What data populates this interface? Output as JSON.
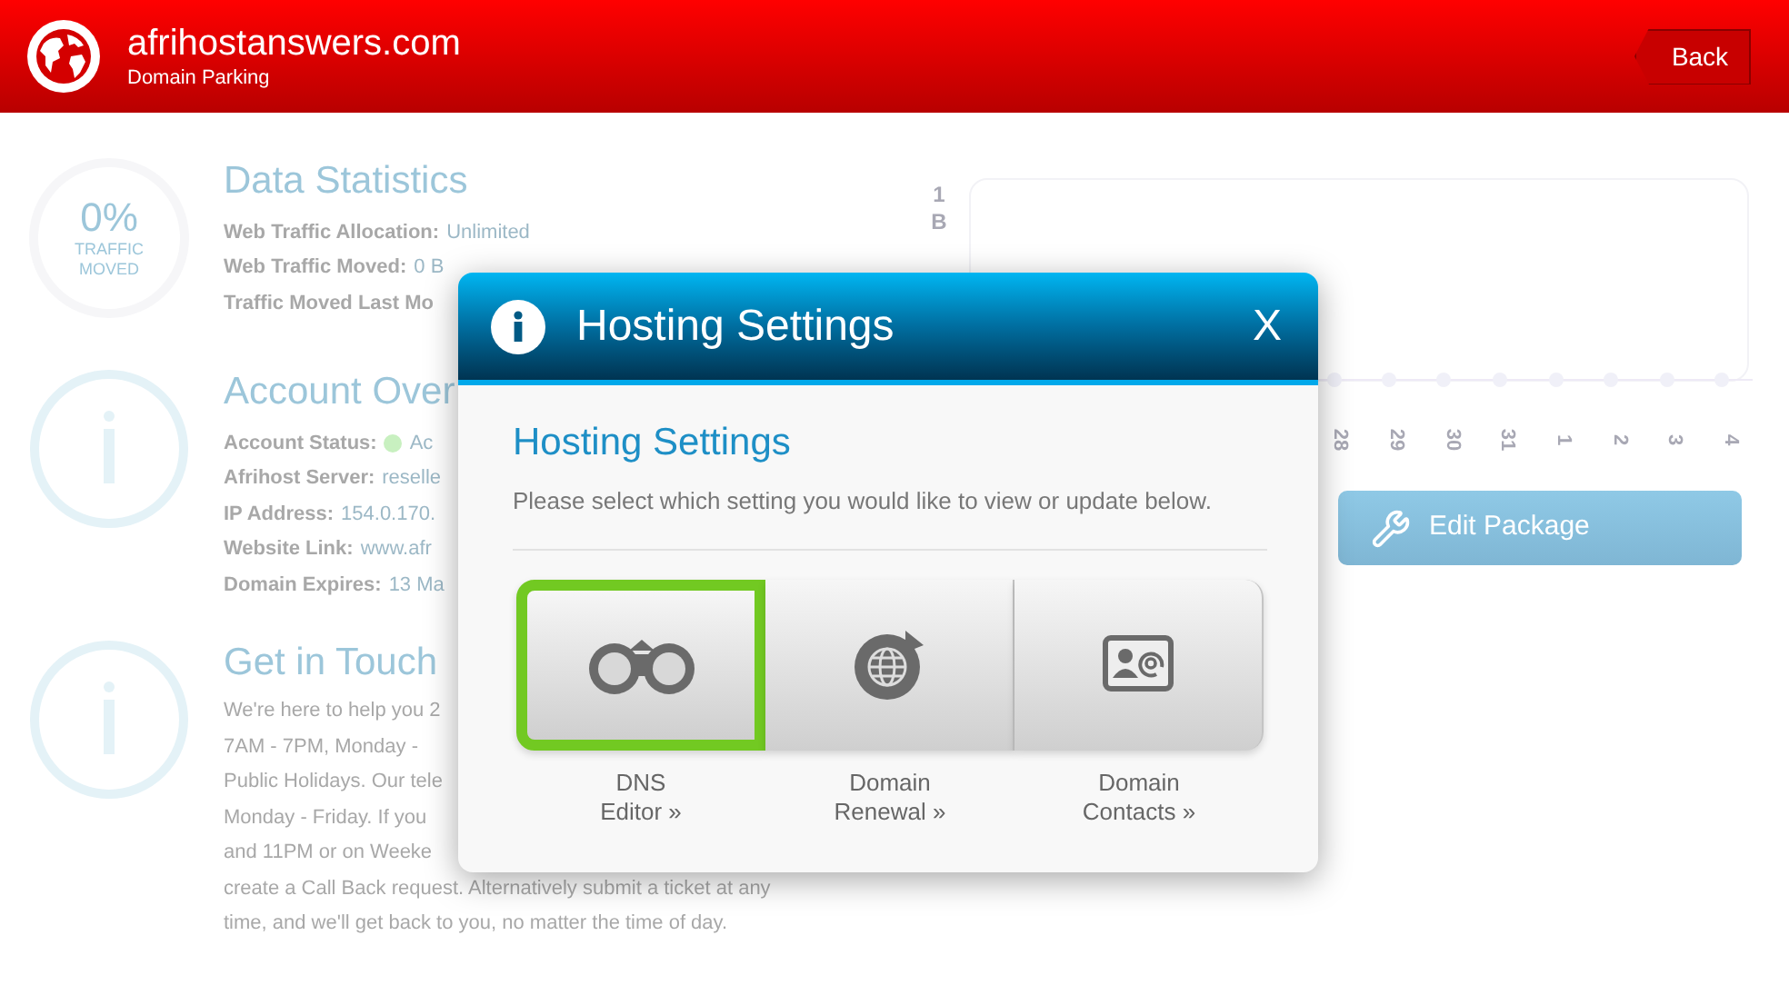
{
  "header": {
    "title": "afrihostanswers.com",
    "subtitle": "Domain Parking",
    "back_button": "Back"
  },
  "sections": [
    {
      "kind": "stat",
      "ring_value": "0%",
      "ring_caption": [
        "TRAFFIC",
        "MOVED"
      ],
      "title": "Data Statistics",
      "rows": [
        {
          "label": "Web Traffic Allocation:",
          "value": "Unlimited"
        },
        {
          "label": "Web Traffic Moved:",
          "value": "0 B"
        },
        {
          "label": "Traffic Moved Last Mo"
        }
      ]
    },
    {
      "kind": "info",
      "title": "Account Over",
      "rows": [
        {
          "label": "Account Status:",
          "value": "Ac",
          "color": "#c8f0c0"
        },
        {
          "label": "Afrihost Server:",
          "value": "reselle"
        },
        {
          "label": "IP Address:",
          "value": "154.0.170."
        },
        {
          "label": "Website Link:",
          "value": "www.afr"
        },
        {
          "label": "Domain Expires:",
          "value": "13 Ma"
        }
      ]
    },
    {
      "kind": "info",
      "title": "Get in Touch",
      "lines": [
        "We're here to help you 2",
        "7AM - 7PM, Monday -",
        "Public Holidays. Our tele",
        "Monday - Friday. If you",
        "and 11PM or on Weeke",
        "create a Call Back request. Alternatively submit a ticket at any",
        "time, and we'll get back to you, no matter the time of day."
      ]
    }
  ],
  "chart": {
    "y_labels": [
      "1",
      "B"
    ],
    "x_labels": [
      "28",
      "29",
      "30",
      "31",
      "1",
      "2",
      "3",
      "4"
    ]
  },
  "edit_button": "Edit Package",
  "dialog": {
    "title": "Hosting Settings",
    "close": "X",
    "heading": "Hosting Settings",
    "description": "Please select which setting you would like to view or update below.",
    "options": [
      {
        "kind": "dns",
        "label": [
          "DNS",
          "Editor »"
        ],
        "selected": true
      },
      {
        "kind": "renewal",
        "label": [
          "Domain",
          "Renewal »"
        ],
        "selected": false
      },
      {
        "kind": "contacts",
        "label": [
          "Domain",
          "Contacts »"
        ],
        "selected": false
      }
    ]
  }
}
